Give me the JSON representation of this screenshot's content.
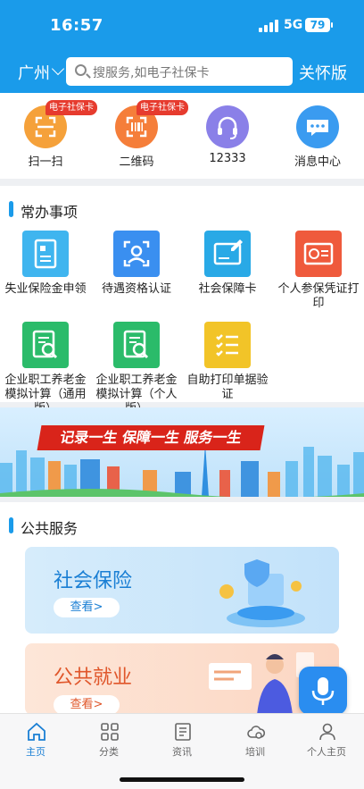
{
  "status": {
    "time": "16:57",
    "network": "5G",
    "battery": "79"
  },
  "header": {
    "city": "广州",
    "search_placeholder": "搜服务,如电子社保卡",
    "care_mode": "关怀版"
  },
  "quick_actions": [
    {
      "label": "扫一扫",
      "badge": "电子社保卡",
      "icon": "scan-icon",
      "color": "#f5a13a"
    },
    {
      "label": "二维码",
      "badge": "电子社保卡",
      "icon": "qrcode-icon",
      "color": "#f57e3a"
    },
    {
      "label": "12333",
      "badge": "",
      "icon": "headset-icon",
      "color": "#8a80e8"
    },
    {
      "label": "消息中心",
      "badge": "",
      "icon": "message-icon",
      "color": "#3a9bf0"
    }
  ],
  "common": {
    "title": "常办事项",
    "items": [
      {
        "label": "失业保险金申领",
        "icon": "document-icon",
        "color": "#3fb5ef"
      },
      {
        "label": "待遇资格认证",
        "icon": "face-scan-icon",
        "color": "#3a8ff0"
      },
      {
        "label": "社会保障卡",
        "icon": "card-icon",
        "color": "#29a9e6"
      },
      {
        "label": "个人参保凭证打印",
        "icon": "certificate-icon",
        "color": "#ef5a3c"
      },
      {
        "label": "企业职工养老金模拟计算（通用版）",
        "icon": "calc-search-icon",
        "color": "#2bbb6a"
      },
      {
        "label": "企业职工养老金模拟计算（个人版）",
        "icon": "calc-search-icon",
        "color": "#2bbb6a"
      },
      {
        "label": "自助打印单据验证",
        "icon": "checklist-icon",
        "color": "#f2c428"
      }
    ]
  },
  "banner": {
    "slogan": "记录一生 保障一生 服务一生"
  },
  "public": {
    "title": "公共服务",
    "cards": [
      {
        "title": "社会保险",
        "button": "查看>"
      },
      {
        "title": "公共就业",
        "button": "查看>"
      }
    ]
  },
  "tabs": [
    {
      "label": "主页",
      "icon": "home-icon",
      "active": true
    },
    {
      "label": "分类",
      "icon": "grid-icon",
      "active": false
    },
    {
      "label": "资讯",
      "icon": "news-icon",
      "active": false
    },
    {
      "label": "培训",
      "icon": "cloud-icon",
      "active": false
    },
    {
      "label": "个人主页",
      "icon": "user-icon",
      "active": false
    }
  ],
  "colors": {
    "brand": "#1a9bea",
    "active_tab": "#1a7fd4",
    "badge": "#e63b2e"
  }
}
